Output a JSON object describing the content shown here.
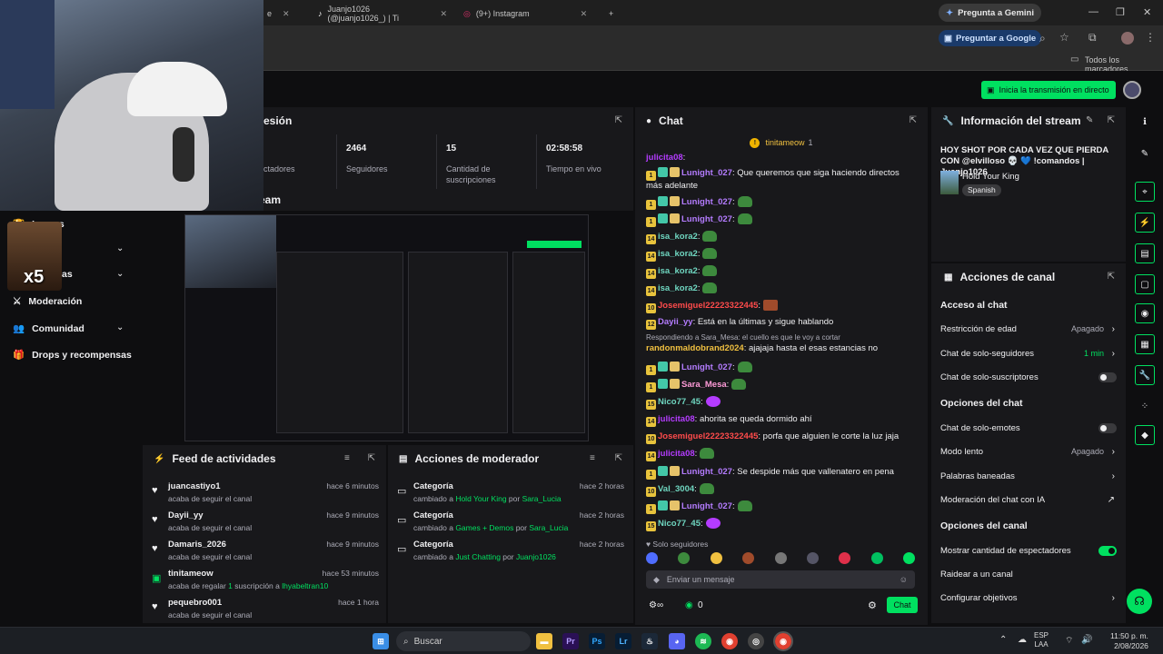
{
  "browser": {
    "tabs": [
      {
        "label": "e",
        "icon": "twitch-icon"
      },
      {
        "label": "Juanjo1026 (@juanjo1026_) | Ti",
        "icon": "tiktok-icon"
      },
      {
        "label": "(9+) Instagram",
        "icon": "instagram-icon"
      }
    ],
    "gemini_label": "Pregunta a Gemini",
    "google_label": "Preguntar a Google",
    "bookmarks_label": "Todos los marcadores"
  },
  "topbar": {
    "golive_label": "Inicia la transmisión en directo"
  },
  "leftnav": {
    "items": [
      {
        "label": "Logros",
        "icon": "trophy-icon"
      },
      {
        "label": "as",
        "icon": "chart-icon"
      },
      {
        "label": "Moderación",
        "icon": "sword-icon"
      },
      {
        "label": "Comunidad",
        "icon": "people-icon"
      },
      {
        "label": "Drops y recompensas",
        "icon": "gift-icon"
      }
    ]
  },
  "session": {
    "title": "esión",
    "stats": [
      {
        "value": "",
        "label": "ectadores"
      },
      {
        "value": "2464",
        "label": "Seguidores"
      },
      {
        "value": "15",
        "label": "Cantidad de suscripciones"
      },
      {
        "value": "02:58:58",
        "label": "Tiempo en vivo"
      }
    ],
    "stream_title": "eam"
  },
  "feed": {
    "title": "Feed de actividades",
    "items": [
      {
        "name": "juancastiyo1",
        "sub": "acaba de seguir el canal",
        "time": "hace 6 minutos",
        "icon": "heart-icon"
      },
      {
        "name": "Dayii_yy",
        "sub": "acaba de seguir el canal",
        "time": "hace 9 minutos",
        "icon": "heart-icon"
      },
      {
        "name": "Damaris_2026",
        "sub": "acaba de seguir el canal",
        "time": "hace 9 minutos",
        "icon": "heart-icon"
      },
      {
        "name": "tinitameow",
        "sub_pre": "acaba de regalar ",
        "sub_count": "1",
        "sub_mid": " suscripción a ",
        "sub_target": "lhyabeltran10",
        "time": "hace 53 minutos",
        "icon": "gift-icon"
      },
      {
        "name": "pequebro001",
        "sub": "acaba de seguir el canal",
        "time": "hace 1 hora",
        "icon": "heart-icon"
      }
    ]
  },
  "modactions": {
    "title": "Acciones de moderador",
    "items": [
      {
        "title": "Categoría",
        "pre": "cambiado a ",
        "target": "Hold Your King",
        "por": " por ",
        "user": "Sara_Lucia",
        "time": "hace 2 horas"
      },
      {
        "title": "Categoría",
        "pre": "cambiado a ",
        "target": "Games + Demos",
        "por": " por ",
        "user": "Sara_Lucia",
        "time": "hace 2 horas"
      },
      {
        "title": "Categoría",
        "pre": "cambiado a ",
        "target": "Just Chatting",
        "por": " por ",
        "user": "Juanjo1026",
        "time": "hace 2 horas"
      }
    ]
  },
  "chat": {
    "title": "Chat",
    "pinned_user": "tinitameow",
    "pinned_count": "1",
    "messages": [
      {
        "badge": "",
        "user": "julicita08",
        "color": "#b43cff",
        "text": ": "
      },
      {
        "badge": "1",
        "user": "Lunight_027",
        "color": "#b47cff",
        "text": ": Que queremos que siga haciendo directos más adelante"
      },
      {
        "badge": "1",
        "user": "Lunight_027",
        "color": "#b47cff",
        "text": ":"
      },
      {
        "badge": "1",
        "user": "Lunight_027",
        "color": "#b47cff",
        "text": ":"
      },
      {
        "badge": "14",
        "user": "isa_kora2",
        "color": "#6fd6c0",
        "text": ":"
      },
      {
        "badge": "14",
        "user": "isa_kora2",
        "color": "#6fd6c0",
        "text": ":"
      },
      {
        "badge": "14",
        "user": "isa_kora2",
        "color": "#6fd6c0",
        "text": ":"
      },
      {
        "badge": "14",
        "user": "isa_kora2",
        "color": "#6fd6c0",
        "text": ":"
      },
      {
        "badge": "10",
        "user": "Josemiguel22223322445",
        "color": "#ff4b4b",
        "text": ":"
      },
      {
        "badge": "12",
        "user": "Dayii_yy",
        "color": "#b47cff",
        "text": ": Está en la últimas y sigue hablando"
      },
      {
        "reply": "Respondiendo a Sara_Mesa: el cuello es que le voy a cortar"
      },
      {
        "badge": "",
        "user": "randonmaldobrand2024",
        "color": "#f0c040",
        "text": ": ajajaja hasta el esas estancias no"
      },
      {
        "badge": "1",
        "user": "Lunight_027",
        "color": "#b47cff",
        "text": ":"
      },
      {
        "badge": "1",
        "user": "Sara_Mesa",
        "color": "#ff9bd8",
        "text": ":"
      },
      {
        "badge": "15",
        "user": "Nico77_45",
        "color": "#6fd6c0",
        "text": ":"
      },
      {
        "badge": "14",
        "user": "julicita08",
        "color": "#b43cff",
        "text": ": ahorita se queda dormido ahí"
      },
      {
        "badge": "10",
        "user": "Josemiguel22223322445",
        "color": "#ff4b4b",
        "text": ": porfa que alguien le corte la luz jaja"
      },
      {
        "badge": "14",
        "user": "julicita08",
        "color": "#b43cff",
        "text": ":"
      },
      {
        "badge": "1",
        "user": "Lunight_027",
        "color": "#b47cff",
        "text": ": Se despide más que vallenatero en pena"
      },
      {
        "badge": "10",
        "user": "Val_3004",
        "color": "#6fd6c0",
        "text": ":"
      },
      {
        "badge": "1",
        "user": "Lunight_027",
        "color": "#b47cff",
        "text": ":"
      },
      {
        "badge": "15",
        "user": "Nico77_45",
        "color": "#6fd6c0",
        "text": ":"
      }
    ],
    "followers_only": "Solo seguidores",
    "input_placeholder": "Enviar un mensaje",
    "points": "0",
    "send_label": "Chat"
  },
  "streaminfo": {
    "title": "Información del stream",
    "headline": "HOY SHOT POR CADA VEZ QUE PIERDA CON @elvilloso 💀 💙 !comandos | Juanjo1026",
    "game": "Hold Your King",
    "language": "Spanish"
  },
  "channel": {
    "title": "Acciones de canal",
    "sections": [
      {
        "heading": "Acceso al chat"
      },
      {
        "label": "Restricción de edad",
        "value": "Apagado",
        "type": "arrow"
      },
      {
        "label": "Chat de solo-seguidores",
        "value": "1 min",
        "type": "arrow"
      },
      {
        "label": "Chat de solo-suscriptores",
        "type": "toggle",
        "on": false
      },
      {
        "heading": "Opciones del chat"
      },
      {
        "label": "Chat de solo-emotes",
        "type": "toggle",
        "on": false
      },
      {
        "label": "Modo lento",
        "value": "Apagado",
        "type": "arrow"
      },
      {
        "label": "Palabras baneadas",
        "type": "arrow"
      },
      {
        "label": "Moderación del chat con IA",
        "type": "external"
      },
      {
        "heading": "Opciones del canal"
      },
      {
        "label": "Mostrar cantidad de espectadores",
        "type": "toggle",
        "on": true
      },
      {
        "label": "Raidear a un canal",
        "type": "none"
      },
      {
        "label": "Configurar objetivos",
        "type": "arrow"
      }
    ]
  },
  "taskbar": {
    "search_label": "Buscar",
    "lang": "ESP",
    "lang2": "LAA",
    "time": "11:50 p. m.",
    "date": "2/08/2026"
  },
  "colors": {
    "accent": "#00e060",
    "panel": "#18181b",
    "bg": "#0e0e10"
  }
}
